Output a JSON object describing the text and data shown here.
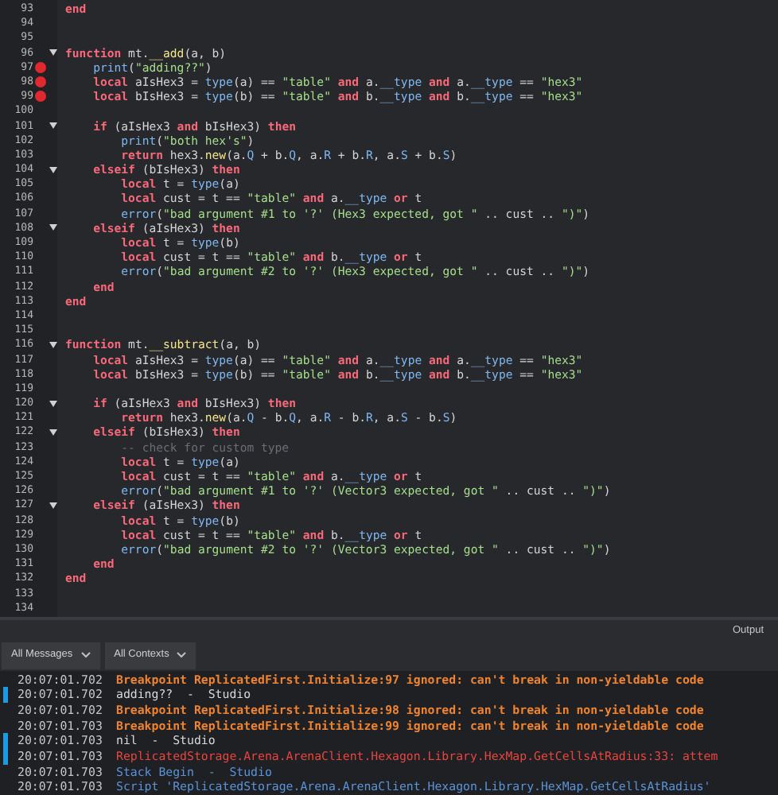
{
  "editor": {
    "lines": [
      {
        "number": "93",
        "breakpoint": false,
        "fold_marker": false,
        "tokens": [
          {
            "kind": "kw",
            "text": "end"
          }
        ]
      },
      {
        "number": "94",
        "breakpoint": false,
        "fold_marker": false
      },
      {
        "number": "95",
        "breakpoint": false,
        "fold_marker": false
      },
      {
        "number": "96",
        "breakpoint": false,
        "fold_marker": true,
        "tokens": [
          {
            "kind": "kw",
            "text": "function"
          },
          {
            "kind": "tx",
            "text": " mt."
          },
          {
            "kind": "def",
            "text": "__add"
          },
          {
            "kind": "tx",
            "text": "(a, b)"
          }
        ]
      },
      {
        "number": "97",
        "breakpoint": true,
        "fold_marker": false,
        "tokens": [
          {
            "kind": "fn",
            "text": "    print"
          },
          {
            "kind": "tx",
            "text": "("
          },
          {
            "kind": "str",
            "text": "\"adding??\""
          },
          {
            "kind": "tx",
            "text": ")"
          }
        ]
      },
      {
        "number": "98",
        "breakpoint": true,
        "fold_marker": false,
        "tokens": [
          {
            "kind": "kw",
            "text": "    local"
          },
          {
            "kind": "tx",
            "text": " aIsHex3 = "
          },
          {
            "kind": "fn",
            "text": "type"
          },
          {
            "kind": "tx",
            "text": "(a) == "
          },
          {
            "kind": "str",
            "text": "\"table\""
          },
          {
            "kind": "kw",
            "text": " and"
          },
          {
            "kind": "tx",
            "text": " a."
          },
          {
            "kind": "field",
            "text": "__type"
          },
          {
            "kind": "kw",
            "text": " and"
          },
          {
            "kind": "tx",
            "text": " a."
          },
          {
            "kind": "field",
            "text": "__type"
          },
          {
            "kind": "tx",
            "text": " == "
          },
          {
            "kind": "str",
            "text": "\"hex3\""
          }
        ]
      },
      {
        "number": "99",
        "breakpoint": true,
        "fold_marker": false,
        "tokens": [
          {
            "kind": "kw",
            "text": "    local"
          },
          {
            "kind": "tx",
            "text": " bIsHex3 = "
          },
          {
            "kind": "fn",
            "text": "type"
          },
          {
            "kind": "tx",
            "text": "(b) == "
          },
          {
            "kind": "str",
            "text": "\"table\""
          },
          {
            "kind": "kw",
            "text": " and"
          },
          {
            "kind": "tx",
            "text": " b."
          },
          {
            "kind": "field",
            "text": "__type"
          },
          {
            "kind": "kw",
            "text": " and"
          },
          {
            "kind": "tx",
            "text": " b."
          },
          {
            "kind": "field",
            "text": "__type"
          },
          {
            "kind": "tx",
            "text": " == "
          },
          {
            "kind": "str",
            "text": "\"hex3\""
          }
        ]
      },
      {
        "number": "100",
        "breakpoint": false,
        "fold_marker": false
      },
      {
        "number": "101",
        "breakpoint": false,
        "fold_marker": true,
        "tokens": [
          {
            "kind": "kw",
            "text": "    if"
          },
          {
            "kind": "tx",
            "text": " (aIsHex3 "
          },
          {
            "kind": "kw",
            "text": "and"
          },
          {
            "kind": "tx",
            "text": " bIsHex3) "
          },
          {
            "kind": "kw",
            "text": "then"
          }
        ]
      },
      {
        "number": "102",
        "breakpoint": false,
        "fold_marker": false,
        "tokens": [
          {
            "kind": "fn",
            "text": "        print"
          },
          {
            "kind": "tx",
            "text": "("
          },
          {
            "kind": "str",
            "text": "\"both hex's\""
          },
          {
            "kind": "tx",
            "text": ")"
          }
        ]
      },
      {
        "number": "103",
        "breakpoint": false,
        "fold_marker": false,
        "tokens": [
          {
            "kind": "kw",
            "text": "        return"
          },
          {
            "kind": "tx",
            "text": " hex3."
          },
          {
            "kind": "def",
            "text": "new"
          },
          {
            "kind": "tx",
            "text": "(a."
          },
          {
            "kind": "field",
            "text": "Q"
          },
          {
            "kind": "tx",
            "text": " + b."
          },
          {
            "kind": "field",
            "text": "Q"
          },
          {
            "kind": "tx",
            "text": ", a."
          },
          {
            "kind": "field",
            "text": "R"
          },
          {
            "kind": "tx",
            "text": " + b."
          },
          {
            "kind": "field",
            "text": "R"
          },
          {
            "kind": "tx",
            "text": ", a."
          },
          {
            "kind": "field",
            "text": "S"
          },
          {
            "kind": "tx",
            "text": " + b."
          },
          {
            "kind": "field",
            "text": "S"
          },
          {
            "kind": "tx",
            "text": ")"
          }
        ]
      },
      {
        "number": "104",
        "breakpoint": false,
        "fold_marker": true,
        "tokens": [
          {
            "kind": "kw",
            "text": "    elseif"
          },
          {
            "kind": "tx",
            "text": " (bIsHex3) "
          },
          {
            "kind": "kw",
            "text": "then"
          }
        ]
      },
      {
        "number": "105",
        "breakpoint": false,
        "fold_marker": false,
        "tokens": [
          {
            "kind": "kw",
            "text": "        local"
          },
          {
            "kind": "tx",
            "text": " t = "
          },
          {
            "kind": "fn",
            "text": "type"
          },
          {
            "kind": "tx",
            "text": "(a)"
          }
        ]
      },
      {
        "number": "106",
        "breakpoint": false,
        "fold_marker": false,
        "tokens": [
          {
            "kind": "kw",
            "text": "        local"
          },
          {
            "kind": "tx",
            "text": " cust = t == "
          },
          {
            "kind": "str",
            "text": "\"table\""
          },
          {
            "kind": "kw",
            "text": " and"
          },
          {
            "kind": "tx",
            "text": " a."
          },
          {
            "kind": "field",
            "text": "__type"
          },
          {
            "kind": "kw",
            "text": " or"
          },
          {
            "kind": "tx",
            "text": " t"
          }
        ]
      },
      {
        "number": "107",
        "breakpoint": false,
        "fold_marker": false,
        "tokens": [
          {
            "kind": "fn",
            "text": "        error"
          },
          {
            "kind": "tx",
            "text": "("
          },
          {
            "kind": "str",
            "text": "\"bad argument #1 to '?' (Hex3 expected, got \""
          },
          {
            "kind": "tx",
            "text": " .. cust .. "
          },
          {
            "kind": "str",
            "text": "\")\""
          },
          {
            "kind": "tx",
            "text": ")"
          }
        ]
      },
      {
        "number": "108",
        "breakpoint": false,
        "fold_marker": true,
        "tokens": [
          {
            "kind": "kw",
            "text": "    elseif"
          },
          {
            "kind": "tx",
            "text": " (aIsHex3) "
          },
          {
            "kind": "kw",
            "text": "then"
          }
        ]
      },
      {
        "number": "109",
        "breakpoint": false,
        "fold_marker": false,
        "tokens": [
          {
            "kind": "kw",
            "text": "        local"
          },
          {
            "kind": "tx",
            "text": " t = "
          },
          {
            "kind": "fn",
            "text": "type"
          },
          {
            "kind": "tx",
            "text": "(b)"
          }
        ]
      },
      {
        "number": "110",
        "breakpoint": false,
        "fold_marker": false,
        "tokens": [
          {
            "kind": "kw",
            "text": "        local"
          },
          {
            "kind": "tx",
            "text": " cust = t == "
          },
          {
            "kind": "str",
            "text": "\"table\""
          },
          {
            "kind": "kw",
            "text": " and"
          },
          {
            "kind": "tx",
            "text": " b."
          },
          {
            "kind": "field",
            "text": "__type"
          },
          {
            "kind": "kw",
            "text": " or"
          },
          {
            "kind": "tx",
            "text": " t"
          }
        ]
      },
      {
        "number": "111",
        "breakpoint": false,
        "fold_marker": false,
        "tokens": [
          {
            "kind": "fn",
            "text": "        error"
          },
          {
            "kind": "tx",
            "text": "("
          },
          {
            "kind": "str",
            "text": "\"bad argument #2 to '?' (Hex3 expected, got \""
          },
          {
            "kind": "tx",
            "text": " .. cust .. "
          },
          {
            "kind": "str",
            "text": "\")\""
          },
          {
            "kind": "tx",
            "text": ")"
          }
        ]
      },
      {
        "number": "112",
        "breakpoint": false,
        "fold_marker": false,
        "tokens": [
          {
            "kind": "kw",
            "text": "    end"
          }
        ]
      },
      {
        "number": "113",
        "breakpoint": false,
        "fold_marker": false,
        "tokens": [
          {
            "kind": "kw",
            "text": "end"
          }
        ]
      },
      {
        "number": "114",
        "breakpoint": false,
        "fold_marker": false
      },
      {
        "number": "115",
        "breakpoint": false,
        "fold_marker": false
      },
      {
        "number": "116",
        "breakpoint": false,
        "fold_marker": true,
        "tokens": [
          {
            "kind": "kw",
            "text": "function"
          },
          {
            "kind": "tx",
            "text": " mt."
          },
          {
            "kind": "def",
            "text": "__subtract"
          },
          {
            "kind": "tx",
            "text": "(a, b)"
          }
        ]
      },
      {
        "number": "117",
        "breakpoint": false,
        "fold_marker": false,
        "tokens": [
          {
            "kind": "kw",
            "text": "    local"
          },
          {
            "kind": "tx",
            "text": " aIsHex3 = "
          },
          {
            "kind": "fn",
            "text": "type"
          },
          {
            "kind": "tx",
            "text": "(a) == "
          },
          {
            "kind": "str",
            "text": "\"table\""
          },
          {
            "kind": "kw",
            "text": " and"
          },
          {
            "kind": "tx",
            "text": " a."
          },
          {
            "kind": "field",
            "text": "__type"
          },
          {
            "kind": "kw",
            "text": " and"
          },
          {
            "kind": "tx",
            "text": " a."
          },
          {
            "kind": "field",
            "text": "__type"
          },
          {
            "kind": "tx",
            "text": " == "
          },
          {
            "kind": "str",
            "text": "\"hex3\""
          }
        ]
      },
      {
        "number": "118",
        "breakpoint": false,
        "fold_marker": false,
        "tokens": [
          {
            "kind": "kw",
            "text": "    local"
          },
          {
            "kind": "tx",
            "text": " bIsHex3 = "
          },
          {
            "kind": "fn",
            "text": "type"
          },
          {
            "kind": "tx",
            "text": "(b) == "
          },
          {
            "kind": "str",
            "text": "\"table\""
          },
          {
            "kind": "kw",
            "text": " and"
          },
          {
            "kind": "tx",
            "text": " b."
          },
          {
            "kind": "field",
            "text": "__type"
          },
          {
            "kind": "kw",
            "text": " and"
          },
          {
            "kind": "tx",
            "text": " b."
          },
          {
            "kind": "field",
            "text": "__type"
          },
          {
            "kind": "tx",
            "text": " == "
          },
          {
            "kind": "str",
            "text": "\"hex3\""
          }
        ]
      },
      {
        "number": "119",
        "breakpoint": false,
        "fold_marker": false
      },
      {
        "number": "120",
        "breakpoint": false,
        "fold_marker": true,
        "tokens": [
          {
            "kind": "kw",
            "text": "    if"
          },
          {
            "kind": "tx",
            "text": " (aIsHex3 "
          },
          {
            "kind": "kw",
            "text": "and"
          },
          {
            "kind": "tx",
            "text": " bIsHex3) "
          },
          {
            "kind": "kw",
            "text": "then"
          }
        ]
      },
      {
        "number": "121",
        "breakpoint": false,
        "fold_marker": false,
        "tokens": [
          {
            "kind": "kw",
            "text": "        return"
          },
          {
            "kind": "tx",
            "text": " hex3."
          },
          {
            "kind": "def",
            "text": "new"
          },
          {
            "kind": "tx",
            "text": "(a."
          },
          {
            "kind": "field",
            "text": "Q"
          },
          {
            "kind": "tx",
            "text": " - b."
          },
          {
            "kind": "field",
            "text": "Q"
          },
          {
            "kind": "tx",
            "text": ", a."
          },
          {
            "kind": "field",
            "text": "R"
          },
          {
            "kind": "tx",
            "text": " - b."
          },
          {
            "kind": "field",
            "text": "R"
          },
          {
            "kind": "tx",
            "text": ", a."
          },
          {
            "kind": "field",
            "text": "S"
          },
          {
            "kind": "tx",
            "text": " - b."
          },
          {
            "kind": "field",
            "text": "S"
          },
          {
            "kind": "tx",
            "text": ")"
          }
        ]
      },
      {
        "number": "122",
        "breakpoint": false,
        "fold_marker": true,
        "tokens": [
          {
            "kind": "kw",
            "text": "    elseif"
          },
          {
            "kind": "tx",
            "text": " (bIsHex3) "
          },
          {
            "kind": "kw",
            "text": "then"
          }
        ]
      },
      {
        "number": "123",
        "breakpoint": false,
        "fold_marker": false,
        "tokens": [
          {
            "kind": "cm",
            "text": "        -- check for custom type"
          }
        ]
      },
      {
        "number": "124",
        "breakpoint": false,
        "fold_marker": false,
        "tokens": [
          {
            "kind": "kw",
            "text": "        local"
          },
          {
            "kind": "tx",
            "text": " t = "
          },
          {
            "kind": "fn",
            "text": "type"
          },
          {
            "kind": "tx",
            "text": "(a)"
          }
        ]
      },
      {
        "number": "125",
        "breakpoint": false,
        "fold_marker": false,
        "tokens": [
          {
            "kind": "kw",
            "text": "        local"
          },
          {
            "kind": "tx",
            "text": " cust = t == "
          },
          {
            "kind": "str",
            "text": "\"table\""
          },
          {
            "kind": "kw",
            "text": " and"
          },
          {
            "kind": "tx",
            "text": " a."
          },
          {
            "kind": "field",
            "text": "__type"
          },
          {
            "kind": "kw",
            "text": " or"
          },
          {
            "kind": "tx",
            "text": " t"
          }
        ]
      },
      {
        "number": "126",
        "breakpoint": false,
        "fold_marker": false,
        "tokens": [
          {
            "kind": "fn",
            "text": "        error"
          },
          {
            "kind": "tx",
            "text": "("
          },
          {
            "kind": "str",
            "text": "\"bad argument #1 to '?' (Vector3 expected, got \""
          },
          {
            "kind": "tx",
            "text": " .. cust .. "
          },
          {
            "kind": "str",
            "text": "\")\""
          },
          {
            "kind": "tx",
            "text": ")"
          }
        ]
      },
      {
        "number": "127",
        "breakpoint": false,
        "fold_marker": true,
        "tokens": [
          {
            "kind": "kw",
            "text": "    elseif"
          },
          {
            "kind": "tx",
            "text": " (aIsHex3) "
          },
          {
            "kind": "kw",
            "text": "then"
          }
        ]
      },
      {
        "number": "128",
        "breakpoint": false,
        "fold_marker": false,
        "tokens": [
          {
            "kind": "kw",
            "text": "        local"
          },
          {
            "kind": "tx",
            "text": " t = "
          },
          {
            "kind": "fn",
            "text": "type"
          },
          {
            "kind": "tx",
            "text": "(b)"
          }
        ]
      },
      {
        "number": "129",
        "breakpoint": false,
        "fold_marker": false,
        "tokens": [
          {
            "kind": "kw",
            "text": "        local"
          },
          {
            "kind": "tx",
            "text": " cust = t == "
          },
          {
            "kind": "str",
            "text": "\"table\""
          },
          {
            "kind": "kw",
            "text": " and"
          },
          {
            "kind": "tx",
            "text": " b."
          },
          {
            "kind": "field",
            "text": "__type"
          },
          {
            "kind": "kw",
            "text": " or"
          },
          {
            "kind": "tx",
            "text": " t"
          }
        ]
      },
      {
        "number": "130",
        "breakpoint": false,
        "fold_marker": false,
        "tokens": [
          {
            "kind": "fn",
            "text": "        error"
          },
          {
            "kind": "tx",
            "text": "("
          },
          {
            "kind": "str",
            "text": "\"bad argument #2 to '?' (Vector3 expected, got \""
          },
          {
            "kind": "tx",
            "text": " .. cust .. "
          },
          {
            "kind": "str",
            "text": "\")\""
          },
          {
            "kind": "tx",
            "text": ")"
          }
        ]
      },
      {
        "number": "131",
        "breakpoint": false,
        "fold_marker": false,
        "tokens": [
          {
            "kind": "kw",
            "text": "    end"
          }
        ]
      },
      {
        "number": "132",
        "breakpoint": false,
        "fold_marker": false,
        "tokens": [
          {
            "kind": "kw",
            "text": "end"
          }
        ]
      },
      {
        "number": "133",
        "breakpoint": false,
        "fold_marker": false
      },
      {
        "number": "134",
        "breakpoint": false,
        "fold_marker": false
      }
    ]
  },
  "output": {
    "title": "Output",
    "filters": [
      "All Messages",
      "All Contexts"
    ],
    "messages": [
      {
        "time": "20:07:01.702",
        "text": "Breakpoint ReplicatedFirst.Initialize:97 ignored: can't break in non-yieldable code",
        "kind": "warning",
        "marker": false
      },
      {
        "time": "20:07:01.702",
        "text": "adding??  -  Studio",
        "kind": "print",
        "marker": true
      },
      {
        "time": "20:07:01.702",
        "text": "Breakpoint ReplicatedFirst.Initialize:98 ignored: can't break in non-yieldable code",
        "kind": "warning",
        "marker": false
      },
      {
        "time": "20:07:01.703",
        "text": "Breakpoint ReplicatedFirst.Initialize:99 ignored: can't break in non-yieldable code",
        "kind": "warning",
        "marker": false
      },
      {
        "time": "20:07:01.703",
        "text": "nil  -  Studio",
        "kind": "print",
        "marker": true
      },
      {
        "time": "20:07:01.703",
        "text": "ReplicatedStorage.Arena.ArenaClient.Hexagon.Library.HexMap.GetCellsAtRadius:33: attem",
        "kind": "error",
        "marker": true
      },
      {
        "time": "20:07:01.703",
        "text": "Stack Begin  -  Studio",
        "kind": "info",
        "marker": false
      },
      {
        "time": "20:07:01.703",
        "text": "Script 'ReplicatedStorage.Arena.ArenaClient.Hexagon.Library.HexMap.GetCellsAtRadius'",
        "kind": "info",
        "marker": false
      }
    ]
  }
}
